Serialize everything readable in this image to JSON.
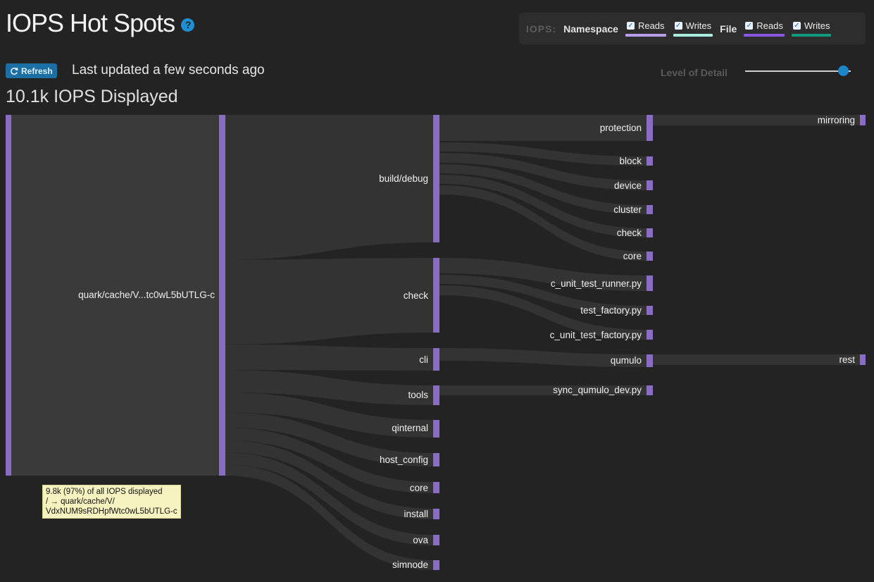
{
  "header": {
    "title": "IOPS Hot Spots",
    "help_glyph": "?"
  },
  "legend": {
    "iops_label": "IOPS:",
    "namespace_label": "Namespace",
    "file_label": "File",
    "namespace_reads": "Reads",
    "namespace_writes": "Writes",
    "file_reads": "Reads",
    "file_writes": "Writes",
    "colors": {
      "namespace_reads": "#b79ee8",
      "namespace_writes": "#a9ece0",
      "file_reads": "#8a57e0",
      "file_writes": "#119a7c"
    }
  },
  "toolbar": {
    "refresh_label": "Refresh",
    "refresh_icon": "refresh-icon",
    "last_updated": "Last updated a few seconds ago",
    "level_of_detail_label": "Level of Detail",
    "level_of_detail_value": 0.93
  },
  "summary": {
    "iops_displayed": "10.1k IOPS Displayed"
  },
  "tree": {
    "root": {
      "label": "quark/cache/V...tc0wL5bUTLG-c"
    },
    "level1": [
      "build/debug",
      "check",
      "cli",
      "tools",
      "qinternal",
      "host_config",
      "core",
      "install",
      "ova",
      "simnode"
    ],
    "level2": [
      "protection",
      "block",
      "device",
      "cluster",
      "check",
      "core",
      "c_unit_test_runner.py",
      "test_factory.py",
      "c_unit_test_factory.py",
      "qumulo",
      "sync_qumulo_dev.py"
    ],
    "level3": [
      "mirroring",
      "rest"
    ]
  },
  "tooltip": {
    "line1": "9.8k (97%) of all IOPS displayed",
    "line2": "/ → quark/cache/V/",
    "line3": "VdxNUM9sRDHpfWtc0wL5bUTLG-c"
  },
  "colors": {
    "background": "#232323",
    "node": "#8a6cc4",
    "link": "#333333",
    "root_fill": "#3a3a3a",
    "accent": "#1b6fa3"
  }
}
